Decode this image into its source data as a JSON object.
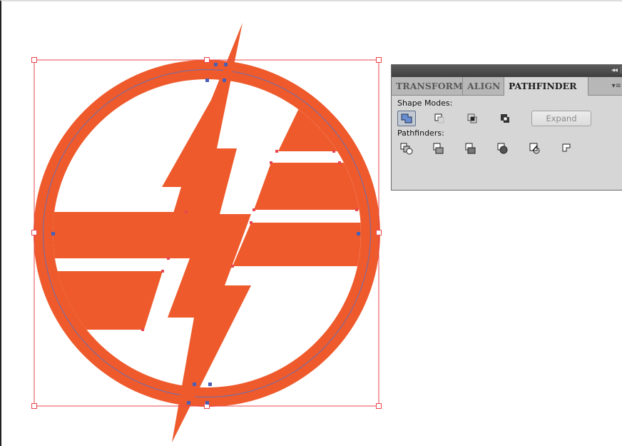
{
  "panel": {
    "collapse_glyph": "◂◂",
    "divider_glyph": "|",
    "tabs": [
      {
        "label": "TRANSFORM"
      },
      {
        "label": "ALIGN"
      },
      {
        "label": "PATHFINDER"
      }
    ],
    "menu_glyph": "▾≡",
    "shape_modes_label": "Shape Modes:",
    "pathfinders_label": "Pathfinders:",
    "expand_label": "Expand",
    "shape_mode_icons": [
      "unite-icon",
      "minus-front-icon",
      "intersect-icon",
      "exclude-icon"
    ],
    "pathfinder_icons": [
      "divide-icon",
      "trim-icon",
      "merge-icon",
      "crop-icon",
      "outline-icon",
      "minus-back-icon"
    ]
  },
  "colors": {
    "logo_orange": "#EE5A2C",
    "selection_red": "#E8474F",
    "anchor_blue": "#4B5FB5",
    "panel_bg": "#D6D6D6"
  }
}
